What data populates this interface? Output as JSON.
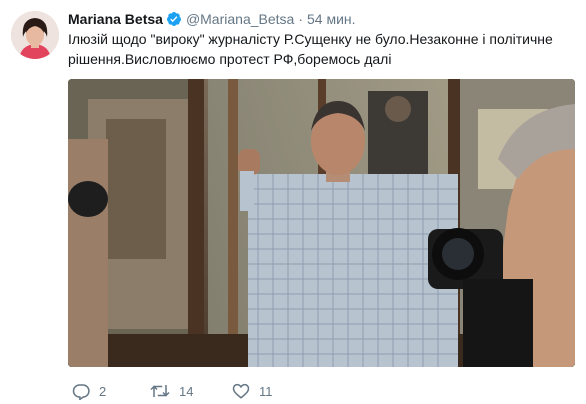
{
  "tweet": {
    "author_name": "Mariana Betsa",
    "handle": "@Mariana_Betsa",
    "separator": "·",
    "time": "54 мин.",
    "text": "Ілюзій щодо \"вироку\" журналісту Р.Сущенку не було.Незаконне і політичне рішення.Висловлюємо протест РФ,боремось далі"
  },
  "actions": {
    "replies": "2",
    "retweets": "14",
    "likes": "11"
  },
  "colors": {
    "text": "#14171a",
    "secondary": "#657786",
    "verified": "#1da1f2"
  },
  "icons": [
    "verified-badge-icon",
    "reply-icon",
    "retweet-icon",
    "like-icon"
  ]
}
